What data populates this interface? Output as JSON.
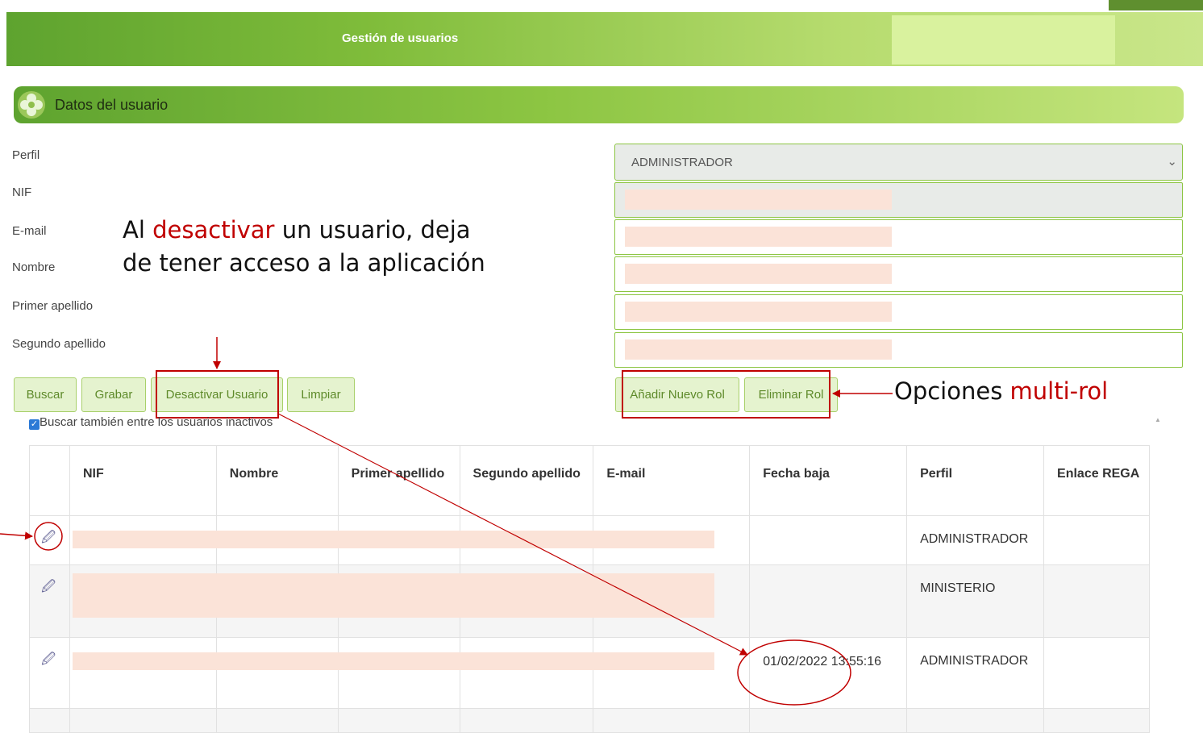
{
  "header": {
    "title": "Gestión de usuarios"
  },
  "section": {
    "title": "Datos del usuario"
  },
  "form": {
    "labels": [
      "Perfil",
      "NIF",
      "E-mail",
      "Nombre",
      "Primer apellido",
      "Segundo apellido"
    ],
    "perfil_value": "ADMINISTRADOR"
  },
  "annotations": {
    "desactivar_pre": "Al ",
    "desactivar_word": "desactivar",
    "desactivar_post": " un usuario, deja de tener acceso a la aplicación",
    "multirol_pre": "Opciones ",
    "multirol_word": "multi-rol"
  },
  "buttons": {
    "buscar": "Buscar",
    "grabar": "Grabar",
    "desactivar": "Desactivar Usuario",
    "limpiar": "Limpiar",
    "anadir_rol": "Añadir Nuevo Rol",
    "eliminar_rol": "Eliminar Rol"
  },
  "checkbox": {
    "label": "Buscar también entre los usuarios inactivos",
    "checked": true
  },
  "table": {
    "headers": [
      "",
      "NIF",
      "Nombre",
      "Primer apellido",
      "Segundo apellido",
      "E-mail",
      "Fecha baja",
      "Perfil",
      "Enlace REGA"
    ],
    "rows": [
      {
        "fecha_baja": "",
        "perfil": "ADMINISTRADOR"
      },
      {
        "fecha_baja": "",
        "perfil": "MINISTERIO"
      },
      {
        "fecha_baja": "01/02/2022 13:55:16",
        "perfil": "ADMINISTRADOR"
      }
    ]
  },
  "colors": {
    "accent": "#8cc542",
    "annotation_red": "#c00000",
    "redaction": "#fbe3d8"
  },
  "icons": {
    "edit": "edit-icon",
    "section": "flower-icon",
    "dropdown": "chevron-down-icon"
  }
}
